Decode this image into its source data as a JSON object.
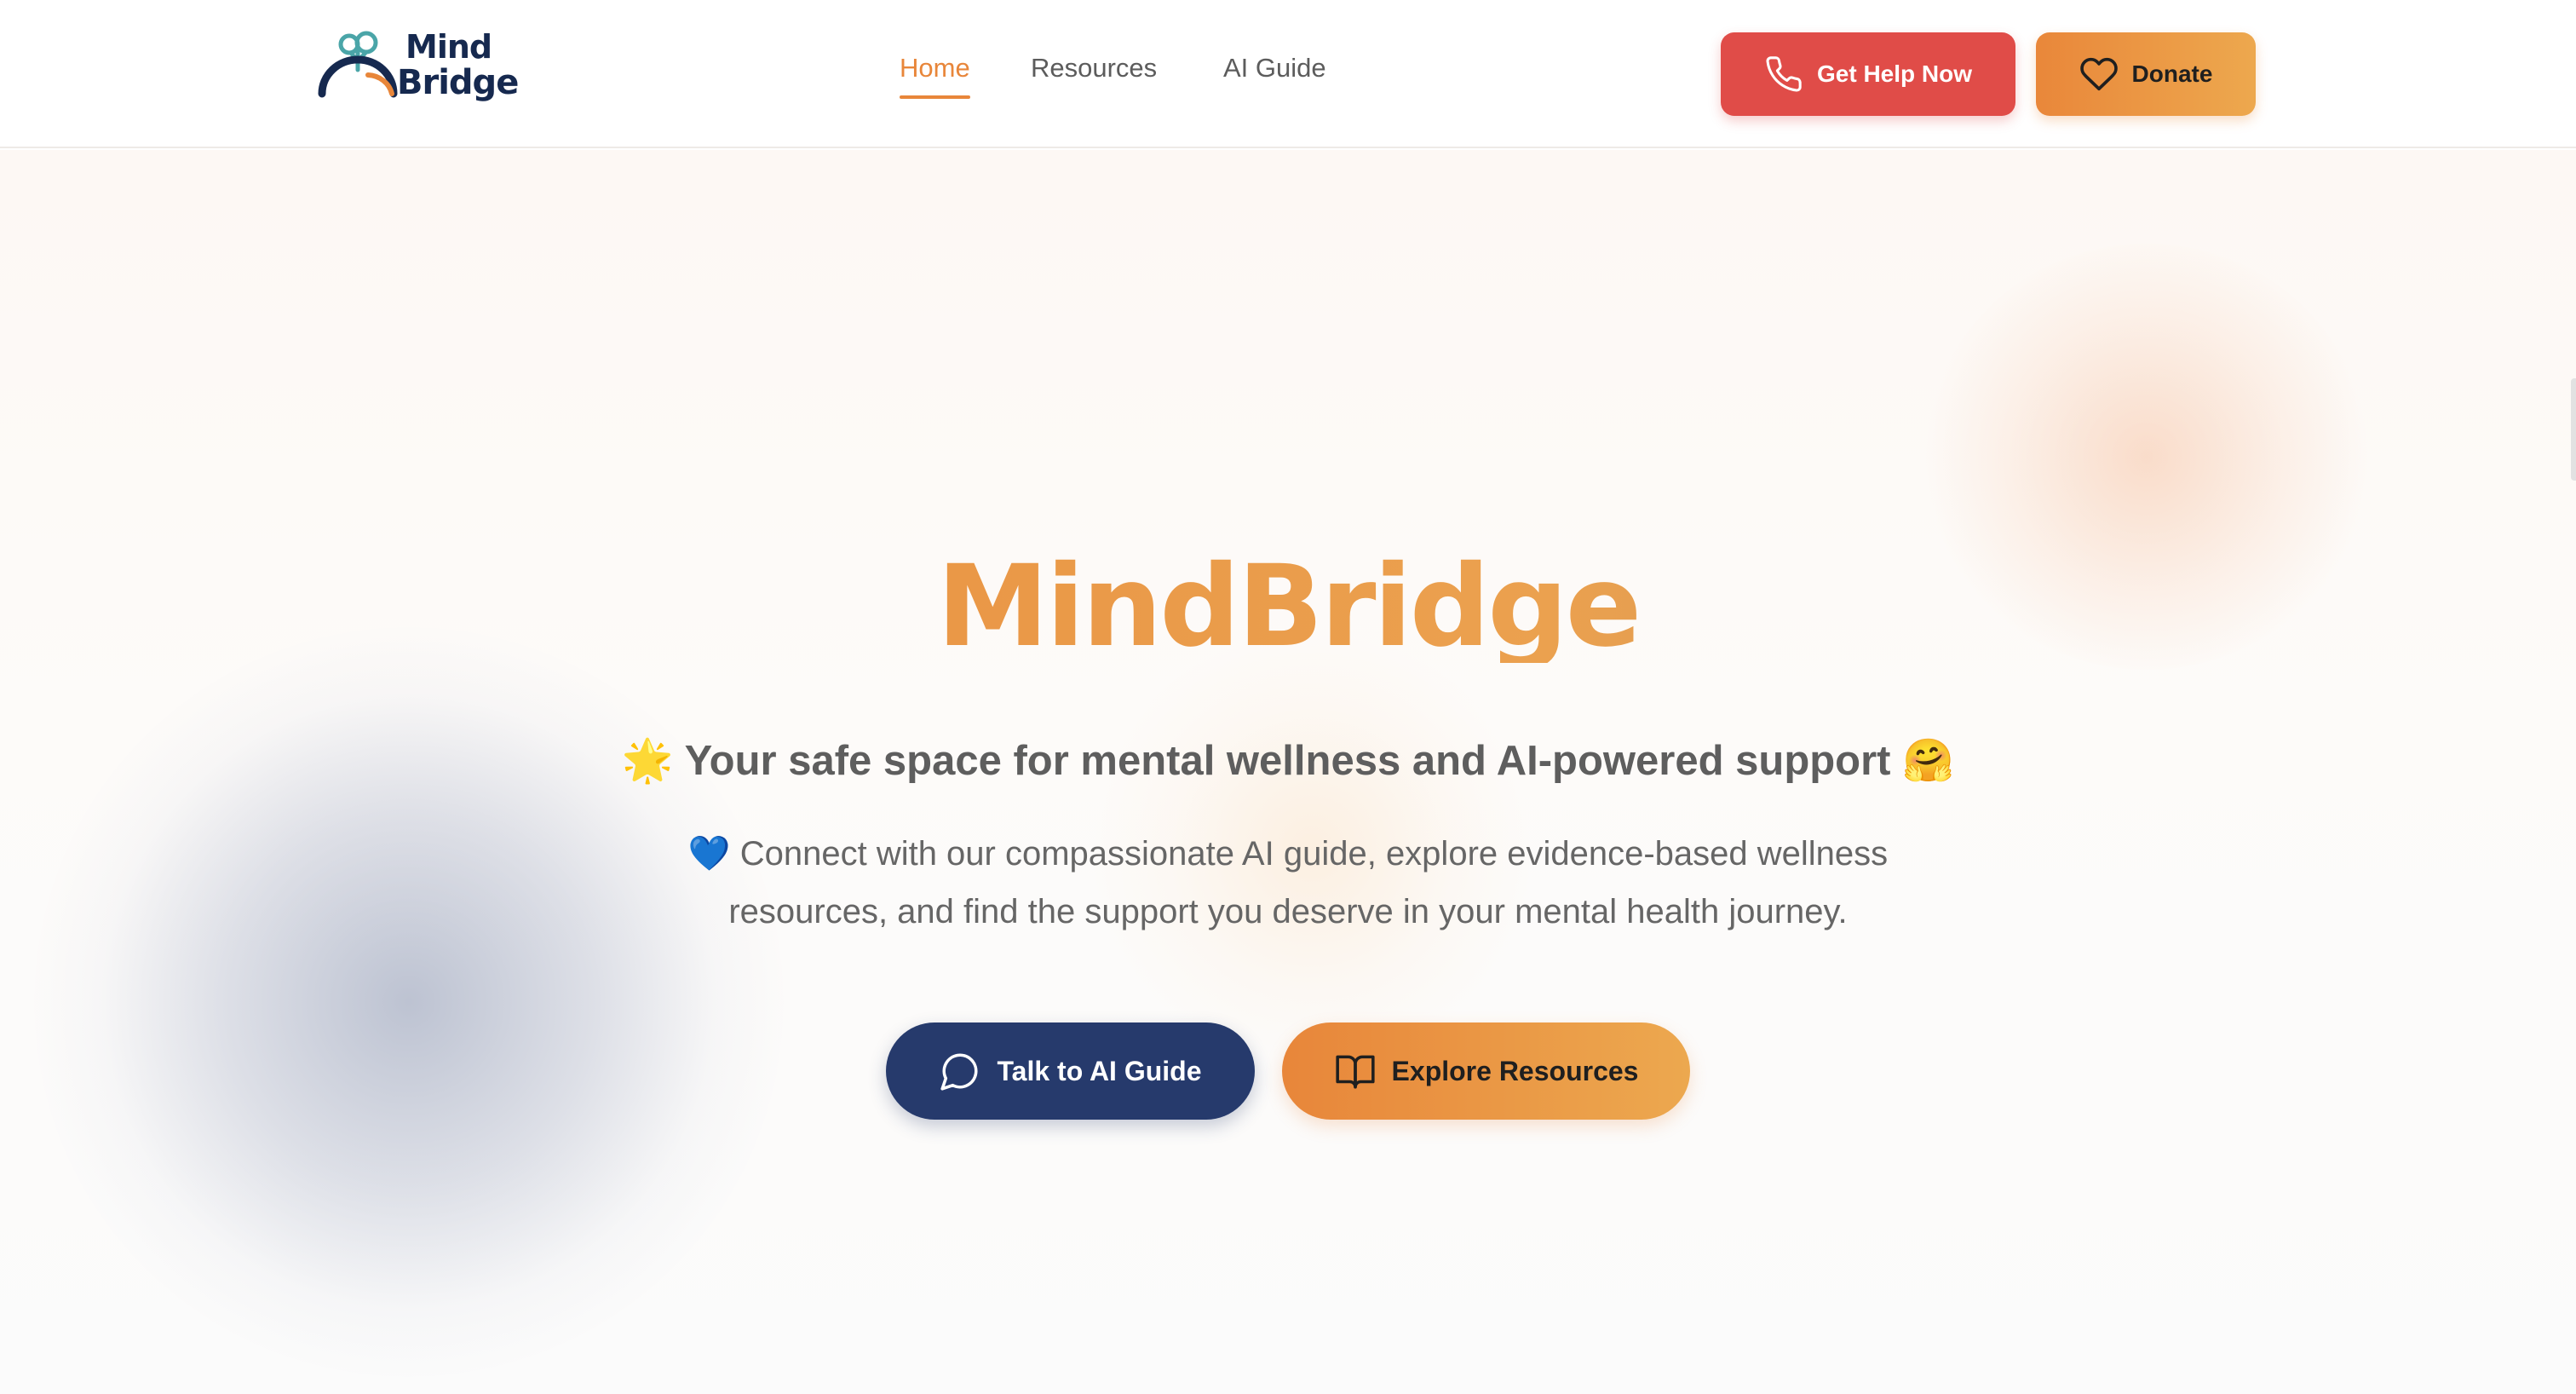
{
  "header": {
    "logo": {
      "line1": "Mind",
      "line2": "Bridge",
      "icon": "brain-arch-icon"
    },
    "nav": [
      {
        "label": "Home",
        "active": true
      },
      {
        "label": "Resources",
        "active": false
      },
      {
        "label": "AI Guide",
        "active": false
      }
    ],
    "help_button": {
      "label": "Get Help Now",
      "icon": "phone-icon"
    },
    "donate_button": {
      "label": "Donate",
      "icon": "heart-icon"
    }
  },
  "hero": {
    "title": "MindBridge",
    "subtitle": "🌟 Your safe space for mental wellness and AI-powered support 🤗",
    "description": "💙 Connect with our compassionate AI guide, explore evidence-based wellness resources, and find the support you deserve in your mental health journey.",
    "primary_button": {
      "label": "Talk to AI Guide",
      "icon": "chat-bubble-icon"
    },
    "secondary_button": {
      "label": "Explore Resources",
      "icon": "open-book-icon"
    }
  },
  "colors": {
    "accent_orange": "#e8863a",
    "help_red": "#e04c48",
    "navy": "#263a6c",
    "logo_navy": "#16294f",
    "logo_teal": "#4aa5a8"
  }
}
